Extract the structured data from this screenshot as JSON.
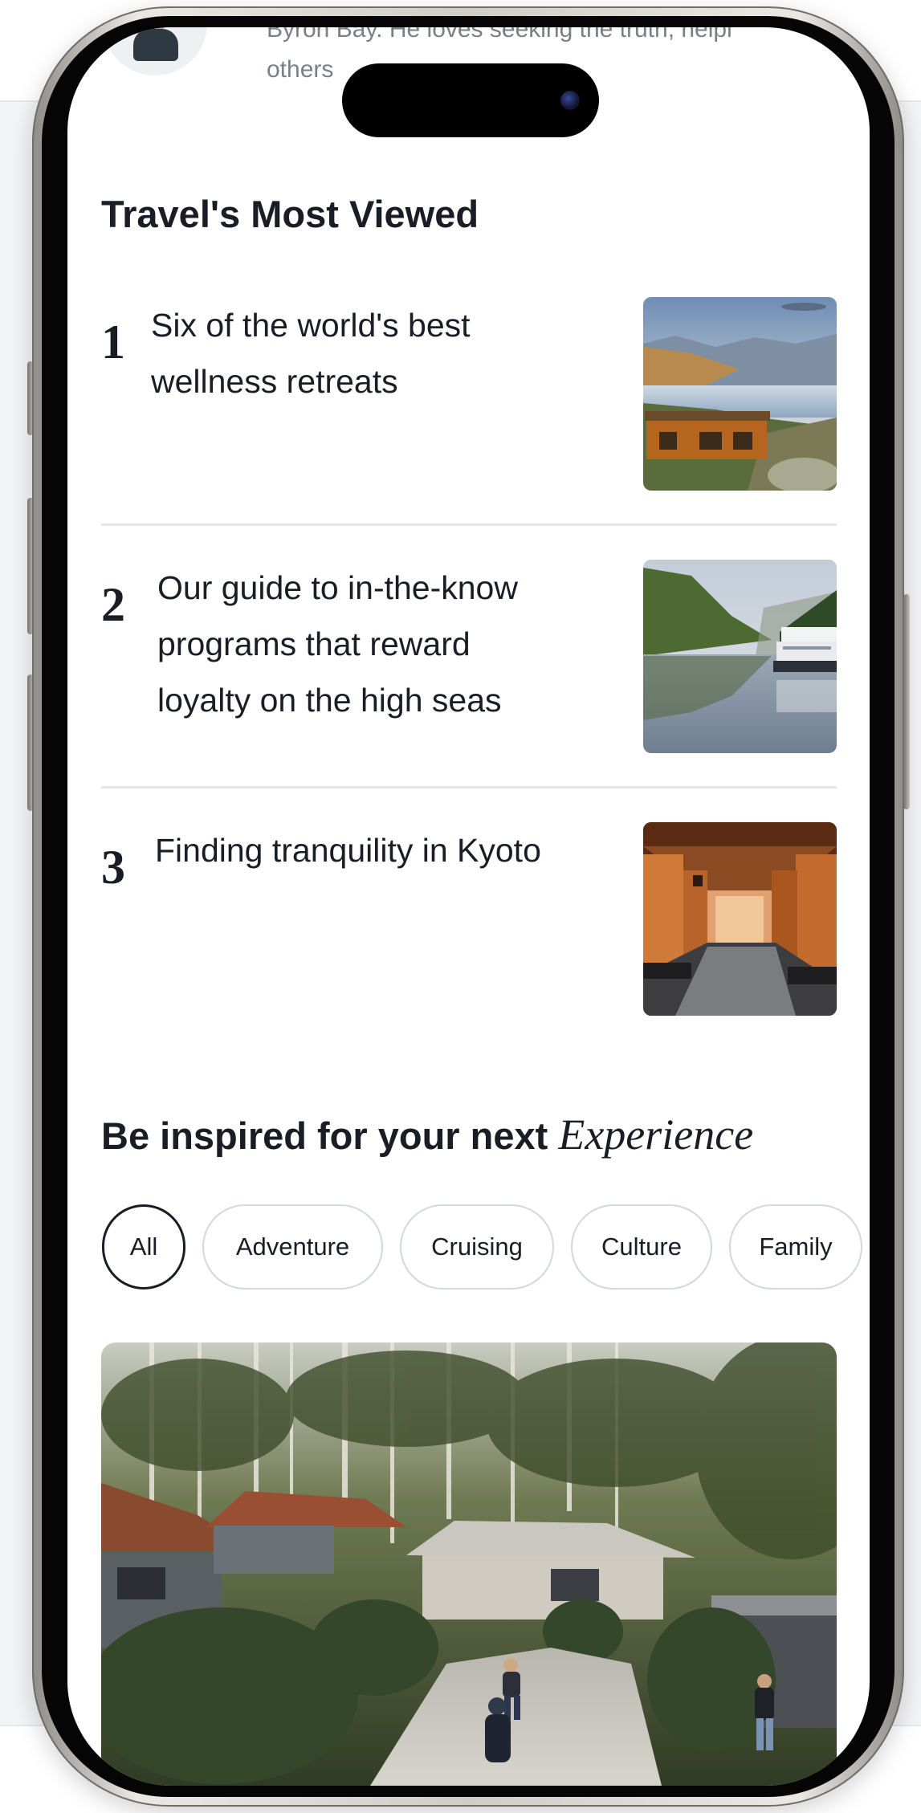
{
  "bio": {
    "line1": "Byron Bay. He loves seeking the truth, helpi",
    "line2": "others"
  },
  "most_viewed": {
    "title": "Travel's Most Viewed",
    "items": [
      {
        "rank": "1",
        "lines": [
          "Six of the world's best",
          "wellness retreats"
        ]
      },
      {
        "rank": "2",
        "lines": [
          "Our guide to in-the-know",
          "programs that reward",
          "loyalty on the high seas"
        ]
      },
      {
        "rank": "3",
        "lines": [
          "Finding tranquility in Kyoto"
        ]
      }
    ]
  },
  "inspire": {
    "title_prefix": "Be inspired for your next",
    "title_accent": "Experience"
  },
  "filters": {
    "selected": "All",
    "items": [
      "All",
      "Adventure",
      "Cruising",
      "Culture",
      "Family"
    ]
  },
  "colors": {
    "text": "#1a1d26",
    "muted": "#7a7f87",
    "divider": "#e4e6e9",
    "pill_border": "#d4d7db"
  }
}
